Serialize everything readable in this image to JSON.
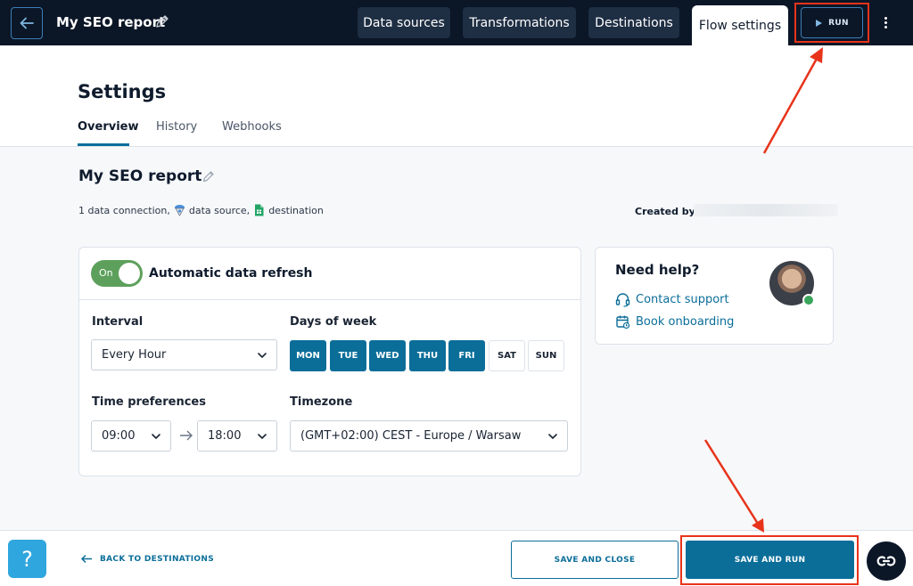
{
  "topbar": {
    "flow_title": "My SEO report",
    "tabs": [
      {
        "label": "Data sources"
      },
      {
        "label": "Transformations"
      },
      {
        "label": "Destinations"
      },
      {
        "label": "Flow settings"
      }
    ],
    "run_label": "RUN"
  },
  "settings": {
    "title": "Settings",
    "subtabs": [
      {
        "label": "Overview"
      },
      {
        "label": "History"
      },
      {
        "label": "Webhooks"
      }
    ]
  },
  "flow": {
    "name": "My SEO report",
    "meta": {
      "connection": "1 data connection,",
      "source": "data source,",
      "destination": "destination"
    },
    "created_by_label": "Created by:"
  },
  "refresh": {
    "toggle_label": "On",
    "toggle_state": "on",
    "title": "Automatic data refresh",
    "interval_label": "Interval",
    "interval_value": "Every Hour",
    "days_label": "Days of week",
    "days": [
      {
        "label": "MON",
        "selected": true
      },
      {
        "label": "TUE",
        "selected": true
      },
      {
        "label": "WED",
        "selected": true
      },
      {
        "label": "THU",
        "selected": true
      },
      {
        "label": "FRI",
        "selected": true
      },
      {
        "label": "SAT",
        "selected": false
      },
      {
        "label": "SUN",
        "selected": false
      }
    ],
    "time_label": "Time preferences",
    "time_from": "09:00",
    "time_to": "18:00",
    "timezone_label": "Timezone",
    "timezone_value": "(GMT+02:00) CEST - Europe / Warsaw"
  },
  "help": {
    "title": "Need help?",
    "contact": "Contact support",
    "onboarding": "Book onboarding"
  },
  "footer": {
    "help_icon": "?",
    "back_label": "BACK TO DESTINATIONS",
    "save_close_label": "SAVE AND CLOSE",
    "save_run_label": "SAVE AND RUN"
  },
  "colors": {
    "topbar_bg": "#0b1627",
    "accent": "#0b6e99",
    "toggle_on": "#5da05c",
    "annotation_red": "#e8331b"
  }
}
